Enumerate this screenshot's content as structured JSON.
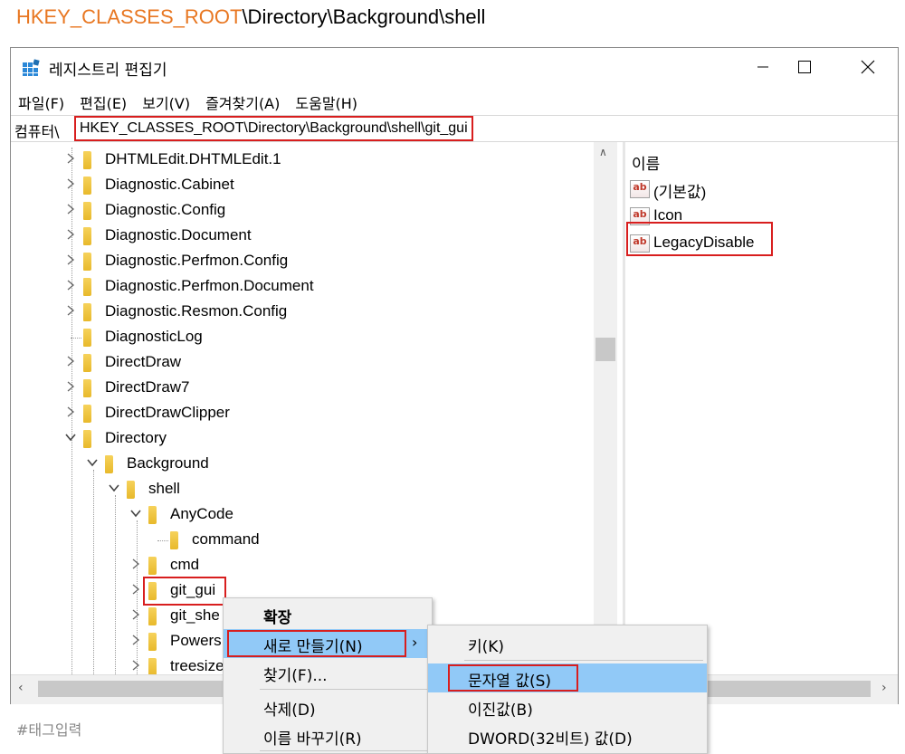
{
  "heading": {
    "root": "HKEY_CLASSES_ROOT",
    "rest": "\\Directory\\Background\\shell"
  },
  "window": {
    "title": "레지스트리 편집기",
    "menu": [
      "파일(F)",
      "편집(E)",
      "보기(V)",
      "즐겨찾기(A)",
      "도움말(H)"
    ],
    "address_prefix": "컴퓨터\\",
    "address_path": "HKEY_CLASSES_ROOT\\Directory\\Background\\shell\\git_gui"
  },
  "tree": [
    {
      "label": "DHTMLEdit.DHTMLEdit.1",
      "level": 0,
      "expander": ">"
    },
    {
      "label": "Diagnostic.Cabinet",
      "level": 0,
      "expander": ">"
    },
    {
      "label": "Diagnostic.Config",
      "level": 0,
      "expander": ">"
    },
    {
      "label": "Diagnostic.Document",
      "level": 0,
      "expander": ">"
    },
    {
      "label": "Diagnostic.Perfmon.Config",
      "level": 0,
      "expander": ">"
    },
    {
      "label": "Diagnostic.Perfmon.Document",
      "level": 0,
      "expander": ">"
    },
    {
      "label": "Diagnostic.Resmon.Config",
      "level": 0,
      "expander": ">"
    },
    {
      "label": "DiagnosticLog",
      "level": 0,
      "expander": ""
    },
    {
      "label": "DirectDraw",
      "level": 0,
      "expander": ">"
    },
    {
      "label": "DirectDraw7",
      "level": 0,
      "expander": ">"
    },
    {
      "label": "DirectDrawClipper",
      "level": 0,
      "expander": ">"
    },
    {
      "label": "Directory",
      "level": 0,
      "expander": "v"
    },
    {
      "label": "Background",
      "level": 1,
      "expander": "v"
    },
    {
      "label": "shell",
      "level": 2,
      "expander": "v"
    },
    {
      "label": "AnyCode",
      "level": 3,
      "expander": "v"
    },
    {
      "label": "command",
      "level": 4,
      "expander": ""
    },
    {
      "label": "cmd",
      "level": 3,
      "expander": ">"
    },
    {
      "label": "git_gui",
      "level": 3,
      "expander": ">"
    },
    {
      "label": "git_she",
      "level": 3,
      "expander": ">"
    },
    {
      "label": "Powers",
      "level": 3,
      "expander": ">"
    },
    {
      "label": "treesize",
      "level": 3,
      "expander": ">"
    }
  ],
  "values": {
    "header": "이름",
    "items": [
      "(기본값)",
      "Icon",
      "LegacyDisable"
    ],
    "icon_text": "ab"
  },
  "context_menu": {
    "items": [
      "확장",
      "새로 만들기(N)",
      "찾기(F)...",
      "삭제(D)",
      "이름 바꾸기(R)"
    ],
    "submenu_arrow": "›"
  },
  "submenu": {
    "items": [
      "키(K)",
      "문자열 값(S)",
      "이진값(B)",
      "DWORD(32비트) 값(D)"
    ]
  },
  "footer_tag": "#태그입력",
  "colors": {
    "accent_orange": "#e87722",
    "highlight_red": "#d81e1e",
    "menu_hover": "#91c9f7"
  }
}
